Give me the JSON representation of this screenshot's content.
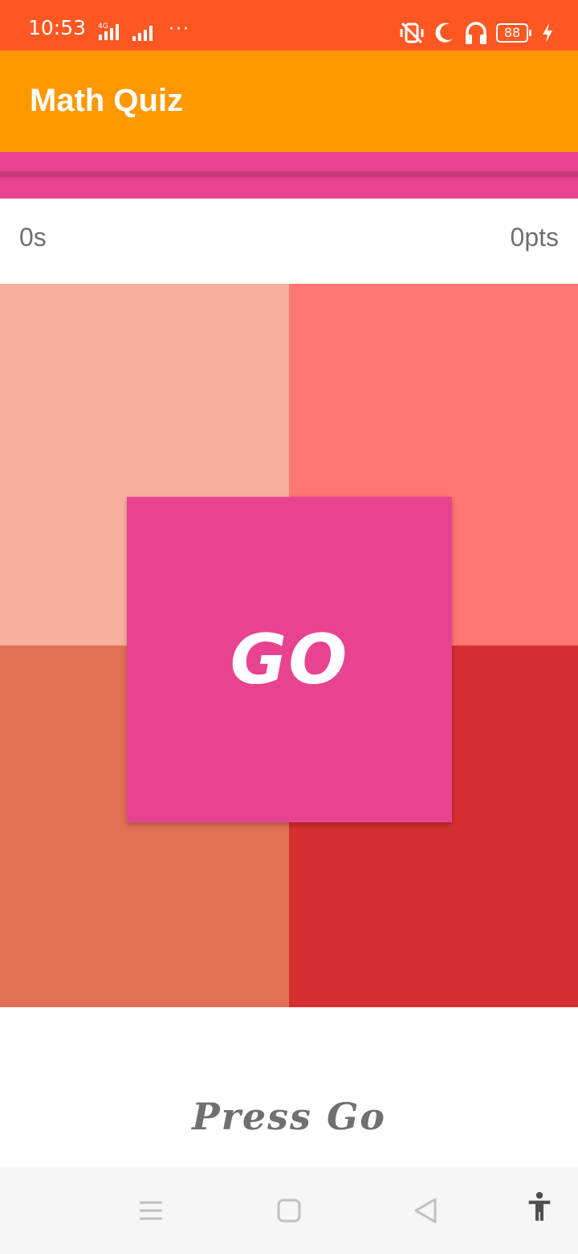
{
  "status_bar": {
    "time": "10:53",
    "network_label": "4G",
    "more_indicator": "···",
    "battery_level": "88",
    "icons": [
      "vibrate-off-icon",
      "moon-icon",
      "headphones-icon",
      "battery-icon",
      "charging-icon"
    ]
  },
  "app_bar": {
    "title": "Math Quiz",
    "color": "#ff9800"
  },
  "stats": {
    "time": "0s",
    "points": "0pts"
  },
  "tiles": {
    "colors": [
      "#f8b09e",
      "#ff7672",
      "#e27055",
      "#d62f2f"
    ]
  },
  "go_button": {
    "label": "GO",
    "color": "#e84390"
  },
  "hint": {
    "text": "Press Go"
  },
  "nav_bar": {
    "icons": [
      "menu-icon",
      "home-icon",
      "back-icon",
      "accessibility-icon"
    ]
  }
}
